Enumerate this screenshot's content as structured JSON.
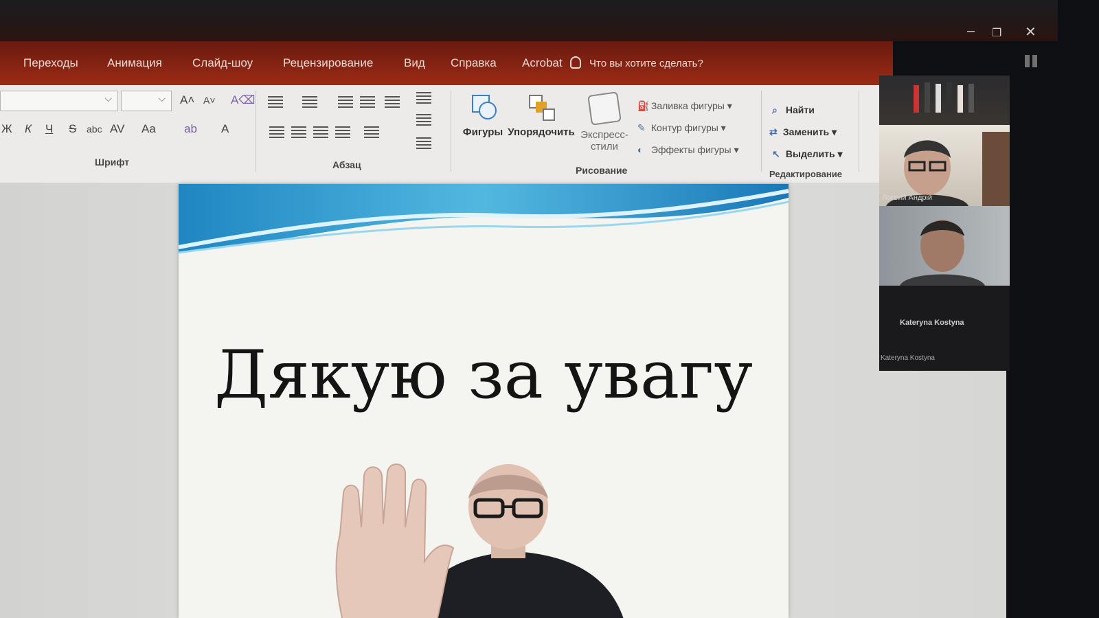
{
  "window": {
    "minimize": "–",
    "maximize": "❐",
    "close": "✕"
  },
  "tabs": [
    "Переходы",
    "Анимация",
    "Слайд-шоу",
    "Рецензирование",
    "Вид",
    "Справка",
    "Acrobat"
  ],
  "tell_me": "Что вы хотите сделать?",
  "ribbon": {
    "font_group": {
      "label": "Шрифт",
      "grow": "A˄",
      "shrink": "A˅",
      "clear": "A⌫",
      "bold": "Ж",
      "italic": "К",
      "underline": "Ч",
      "strike": "S",
      "shadow": "abc",
      "spacing": "AV",
      "case": "Aa",
      "highlight": "ab",
      "color": "A"
    },
    "paragraph_group": {
      "label": "Абзац"
    },
    "drawing_group": {
      "label": "Рисование",
      "shapes": "Фигуры",
      "arrange": "Упорядочить",
      "quick_styles_1": "Экспресс-",
      "quick_styles_2": "стили",
      "fill": "Заливка фигуры",
      "outline": "Контур фигуры",
      "effects": "Эффекты фигуры"
    },
    "editing_group": {
      "label": "Редактирование",
      "find": "Найти",
      "replace": "Заменить",
      "select": "Выделить"
    }
  },
  "slide": {
    "title": "Дякую за увагу"
  },
  "participants": [
    {
      "name": "Логвий Андрій"
    },
    {
      "name": ""
    },
    {
      "name": "Kateryna Kostyna",
      "label": "Kateryna Kostyna"
    }
  ]
}
